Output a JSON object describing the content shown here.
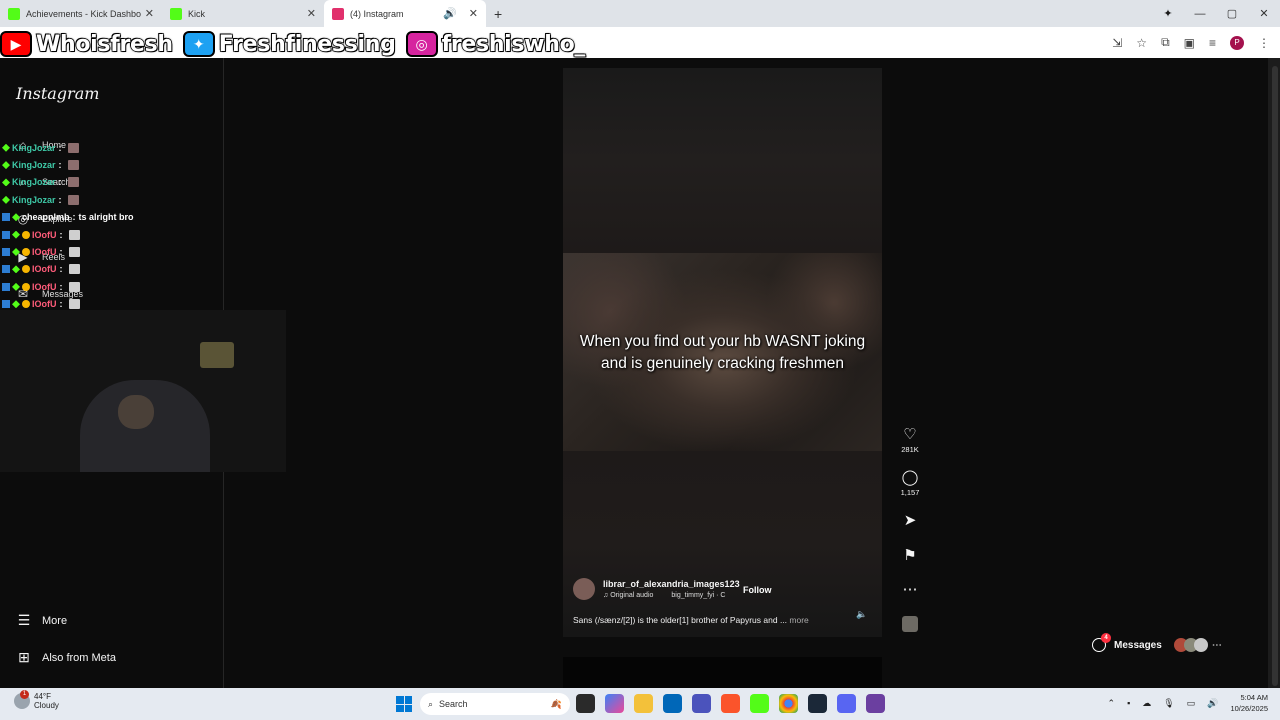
{
  "browser": {
    "tabs": [
      {
        "title": "Achievements - Kick Dashboard",
        "favicon_color": "#53fc18"
      },
      {
        "title": "Kick",
        "favicon_color": "#53fc18"
      },
      {
        "title": "(4) Instagram",
        "favicon_color": "#e1306c",
        "active": true
      }
    ],
    "new_tab": "+",
    "window_controls": [
      "—",
      "▢",
      "✕"
    ],
    "profile_initial": "P"
  },
  "overlay": {
    "youtube": "Whoisfresh",
    "twitter": "Freshfinessing",
    "instagram": "freshiswho_"
  },
  "sidebar": {
    "logo": "Instagram",
    "items": [
      {
        "label": "Home",
        "icon": "home-icon"
      },
      {
        "label": "Search",
        "icon": "search-icon"
      },
      {
        "label": "Explore",
        "icon": "compass-icon"
      },
      {
        "label": "Reels",
        "icon": "reels-icon"
      },
      {
        "label": "Messages",
        "icon": "messenger-icon"
      }
    ],
    "more": "More",
    "also_from_meta": "Also from Meta"
  },
  "chat": [
    {
      "user": "KingJozar",
      "color": "#3ec9a7",
      "msg": "",
      "badges": [
        "gift"
      ],
      "emote": true
    },
    {
      "user": "KingJozar",
      "color": "#3ec9a7",
      "msg": "",
      "badges": [
        "gift"
      ],
      "emote": true
    },
    {
      "user": "KingJozar",
      "color": "#3ec9a7",
      "msg": "",
      "badges": [
        "gift"
      ],
      "emote": true
    },
    {
      "user": "KingJozar",
      "color": "#3ec9a7",
      "msg": "",
      "badges": [
        "gift"
      ],
      "emote": true
    },
    {
      "user": "cheapnlmb",
      "color": "#ffffff",
      "msg": "ts alright bro",
      "badges": [
        "mod",
        "gift"
      ],
      "emote": false
    },
    {
      "user": "IOofU",
      "color": "#ff5c7a",
      "msg": "",
      "badges": [
        "mod",
        "gift",
        "sub"
      ],
      "emote": true
    },
    {
      "user": "IOofU",
      "color": "#ff5c7a",
      "msg": "",
      "badges": [
        "mod",
        "gift",
        "sub"
      ],
      "emote": true
    },
    {
      "user": "IOofU",
      "color": "#ff5c7a",
      "msg": "",
      "badges": [
        "mod",
        "gift",
        "sub"
      ],
      "emote": true
    },
    {
      "user": "IOofU",
      "color": "#ff5c7a",
      "msg": "",
      "badges": [
        "mod",
        "gift",
        "sub"
      ],
      "emote": true
    },
    {
      "user": "IOofU",
      "color": "#ff5c7a",
      "msg": "",
      "badges": [
        "mod",
        "gift",
        "sub"
      ],
      "emote": true
    }
  ],
  "reel": {
    "caption": "When you find out your hb WASNT joking and is genuinely cracking freshmen",
    "author": "librar_of_alexandria_images123",
    "audio": "Original audio",
    "audio_credit": "big_timmy_fyi · C",
    "follow": "Follow",
    "description": "Sans (/sænz/[2]) is the older[1] brother of Papyrus and ...",
    "more": "more"
  },
  "actions": {
    "likes": "281K",
    "comments": "1,157"
  },
  "messages_pill": {
    "label": "Messages",
    "badge": "4"
  },
  "taskbar": {
    "temp": "44°F",
    "condition": "Cloudy",
    "weather_badge": "1",
    "search": "Search",
    "time": "5:04 AM",
    "date": "10/26/2025"
  }
}
